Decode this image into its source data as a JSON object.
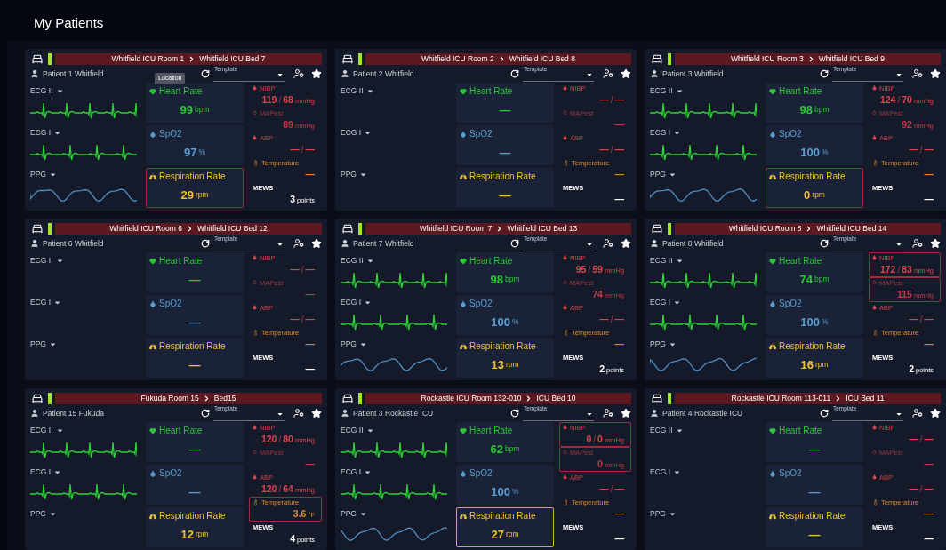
{
  "title": "My Patients",
  "cards": [
    {
      "room": "Whitfield ICU Room 1",
      "bed": "Whitfield ICU Bed 7",
      "patient": "Patient 1 Whitfield",
      "template": "Template",
      "tooltip": "Location",
      "waves": [
        {
          "label": "ECG II",
          "kind": "ecg"
        },
        {
          "label": "ECG I",
          "kind": "ecg"
        },
        {
          "label": "PPG",
          "kind": "ppg"
        }
      ],
      "tiles": [
        {
          "kind": "hr",
          "label": "Heart Rate",
          "value": "99",
          "unit": "bpm",
          "alarm": false
        },
        {
          "kind": "spo2",
          "label": "SpO2",
          "value": "97",
          "unit": "%",
          "alarm": false
        },
        {
          "kind": "rr",
          "label": "Respiration Rate",
          "value": "29",
          "unit": "rpm",
          "alarm": true,
          "color": "#a3283a"
        }
      ],
      "side": [
        {
          "kind": "nibp",
          "label": "NIBP",
          "values": [
            "119",
            "68"
          ],
          "sep": "/",
          "unit": "mmHg",
          "alarm": false
        },
        {
          "kind": "map",
          "label": "MAPest",
          "value": "89",
          "unit": "mmHg",
          "alarm": false
        },
        {
          "kind": "abp",
          "label": "ABP",
          "values": [
            "—",
            "—"
          ],
          "sep": "/",
          "alarm": false
        },
        {
          "kind": "temp",
          "label": "Temperature",
          "value": "—",
          "alarm": false
        },
        {
          "kind": "mews",
          "label": "MEWS",
          "value": "3",
          "unit": "points",
          "alarm": false
        }
      ]
    },
    {
      "room": "Whitfield ICU Room 2",
      "bed": "Whitfield ICU Bed 8",
      "patient": "Patient 2 Whitfield",
      "template": "Template",
      "waves": [
        {
          "label": "ECG II",
          "kind": "empty"
        },
        {
          "label": "ECG I",
          "kind": "empty"
        },
        {
          "label": "PPG",
          "kind": "empty"
        }
      ],
      "tiles": [
        {
          "kind": "hr",
          "label": "Heart Rate",
          "value": "—",
          "alarm": false
        },
        {
          "kind": "spo2",
          "label": "SpO2",
          "value": "—",
          "alarm": false
        },
        {
          "kind": "rr",
          "label": "Respiration Rate",
          "value": "—",
          "alarm": false
        }
      ],
      "side": [
        {
          "kind": "nibp",
          "label": "NIBP",
          "values": [
            "—",
            "—"
          ],
          "sep": "/",
          "alarm": false
        },
        {
          "kind": "map",
          "label": "MAPest",
          "value": "—",
          "alarm": false
        },
        {
          "kind": "abp",
          "label": "ABP",
          "values": [
            "—",
            "—"
          ],
          "sep": "/",
          "alarm": false
        },
        {
          "kind": "temp",
          "label": "Temperature",
          "value": "—",
          "alarm": false
        },
        {
          "kind": "mews",
          "label": "MEWS",
          "value": "—",
          "alarm": false
        }
      ]
    },
    {
      "room": "Whitfield ICU Room 3",
      "bed": "Whitfield ICU Bed 9",
      "patient": "Patient 3 Whitfield",
      "template": "Template",
      "waves": [
        {
          "label": "ECG II",
          "kind": "ecg"
        },
        {
          "label": "ECG I",
          "kind": "ecg"
        },
        {
          "label": "PPG",
          "kind": "ppg"
        }
      ],
      "tiles": [
        {
          "kind": "hr",
          "label": "Heart Rate",
          "value": "98",
          "unit": "bpm",
          "alarm": false
        },
        {
          "kind": "spo2",
          "label": "SpO2",
          "value": "100",
          "unit": "%",
          "alarm": false
        },
        {
          "kind": "rr",
          "label": "Respiration Rate",
          "value": "0",
          "unit": "rpm",
          "alarm": true,
          "color": "#a3283a"
        }
      ],
      "side": [
        {
          "kind": "nibp",
          "label": "NIBP",
          "values": [
            "124",
            "70"
          ],
          "sep": "/",
          "unit": "mmHg",
          "alarm": false
        },
        {
          "kind": "map",
          "label": "MAPest",
          "value": "92",
          "unit": "mmHg",
          "alarm": false
        },
        {
          "kind": "abp",
          "label": "ABP",
          "values": [
            "—",
            "—"
          ],
          "sep": "/",
          "alarm": false
        },
        {
          "kind": "temp",
          "label": "Temperature",
          "value": "—",
          "alarm": false
        },
        {
          "kind": "mews",
          "label": "MEWS",
          "value": "—",
          "alarm": false
        }
      ]
    },
    {
      "room": "Whitfield ICU Room 6",
      "bed": "Whitfield ICU Bed 12",
      "patient": "Patient 6 Whitfield",
      "template": "Template",
      "waves": [
        {
          "label": "ECG II",
          "kind": "empty"
        },
        {
          "label": "ECG I",
          "kind": "empty"
        },
        {
          "label": "PPG",
          "kind": "empty"
        }
      ],
      "tiles": [
        {
          "kind": "hr",
          "label": "Heart Rate",
          "value": "—",
          "alarm": false
        },
        {
          "kind": "spo2",
          "label": "SpO2",
          "value": "—",
          "alarm": false
        },
        {
          "kind": "rr",
          "label": "Respiration Rate",
          "value": "—",
          "alarm": false
        }
      ],
      "side": [
        {
          "kind": "nibp",
          "label": "NIBP",
          "values": [
            "—",
            "—"
          ],
          "sep": "/",
          "alarm": false
        },
        {
          "kind": "map",
          "label": "MAPest",
          "value": "—",
          "alarm": false
        },
        {
          "kind": "abp",
          "label": "ABP",
          "values": [
            "—",
            "—"
          ],
          "sep": "/",
          "alarm": false
        },
        {
          "kind": "temp",
          "label": "Temperature",
          "value": "—",
          "alarm": false
        },
        {
          "kind": "mews",
          "label": "MEWS",
          "value": "—",
          "alarm": false
        }
      ]
    },
    {
      "room": "Whitfield ICU Room 7",
      "bed": "Whitfield ICU Bed 13",
      "patient": "Patient 7 Whitfield",
      "template": "Template",
      "waves": [
        {
          "label": "ECG II",
          "kind": "ecg"
        },
        {
          "label": "ECG I",
          "kind": "ecg"
        },
        {
          "label": "PPG",
          "kind": "ppg"
        }
      ],
      "tiles": [
        {
          "kind": "hr",
          "label": "Heart Rate",
          "value": "98",
          "unit": "bpm",
          "alarm": false
        },
        {
          "kind": "spo2",
          "label": "SpO2",
          "value": "100",
          "unit": "%",
          "alarm": false
        },
        {
          "kind": "rr",
          "label": "Respiration Rate",
          "value": "13",
          "unit": "rpm",
          "alarm": false
        }
      ],
      "side": [
        {
          "kind": "nibp",
          "label": "NIBP",
          "values": [
            "95",
            "59"
          ],
          "sep": "/",
          "unit": "mmHg",
          "alarm": false
        },
        {
          "kind": "map",
          "label": "MAPest",
          "value": "74",
          "unit": "mmHg",
          "alarm": false
        },
        {
          "kind": "abp",
          "label": "ABP",
          "values": [
            "—",
            "—"
          ],
          "sep": "/",
          "alarm": false
        },
        {
          "kind": "temp",
          "label": "Temperature",
          "value": "—",
          "alarm": false
        },
        {
          "kind": "mews",
          "label": "MEWS",
          "value": "2",
          "unit": "points",
          "alarm": false
        }
      ]
    },
    {
      "room": "Whitfield ICU Room 8",
      "bed": "Whitfield ICU Bed 14",
      "patient": "Patient 8 Whitfield",
      "template": "Template",
      "waves": [
        {
          "label": "ECG II",
          "kind": "ecg"
        },
        {
          "label": "ECG I",
          "kind": "ecg"
        },
        {
          "label": "PPG",
          "kind": "ppg"
        }
      ],
      "tiles": [
        {
          "kind": "hr",
          "label": "Heart Rate",
          "value": "74",
          "unit": "bpm",
          "alarm": false
        },
        {
          "kind": "spo2",
          "label": "SpO2",
          "value": "100",
          "unit": "%",
          "alarm": false
        },
        {
          "kind": "rr",
          "label": "Respiration Rate",
          "value": "16",
          "unit": "rpm",
          "alarm": false
        }
      ],
      "side": [
        {
          "kind": "nibp",
          "label": "NIBP",
          "values": [
            "172",
            "83"
          ],
          "sep": "/",
          "unit": "mmHg",
          "alarm": true,
          "color": "#a3283a"
        },
        {
          "kind": "map",
          "label": "MAPest",
          "value": "115",
          "unit": "mmHg",
          "alarm": true,
          "color": "#a3283a"
        },
        {
          "kind": "abp",
          "label": "ABP",
          "values": [
            "—",
            "—"
          ],
          "sep": "/",
          "alarm": false
        },
        {
          "kind": "temp",
          "label": "Temperature",
          "value": "—",
          "alarm": false
        },
        {
          "kind": "mews",
          "label": "MEWS",
          "value": "2",
          "unit": "points",
          "alarm": false
        }
      ]
    },
    {
      "room": "Fukuda Room 15",
      "bed": "Bed15",
      "patient": "Patient 15 Fukuda",
      "template": "Template",
      "waves": [
        {
          "label": "ECG II",
          "kind": "ecg"
        },
        {
          "label": "ECG I",
          "kind": "ecg"
        },
        {
          "label": "PPG",
          "kind": "empty"
        }
      ],
      "tiles": [
        {
          "kind": "hr",
          "label": "Heart Rate",
          "value": "—",
          "alarm": false
        },
        {
          "kind": "spo2",
          "label": "SpO2",
          "value": "—",
          "alarm": false
        },
        {
          "kind": "rr",
          "label": "Respiration Rate",
          "value": "12",
          "unit": "rpm",
          "alarm": false
        }
      ],
      "side": [
        {
          "kind": "nibp",
          "label": "NIBP",
          "values": [
            "120",
            "80"
          ],
          "sep": "/",
          "unit": "mmHg",
          "alarm": false
        },
        {
          "kind": "map",
          "label": "MAPest",
          "value": "—",
          "alarm": false
        },
        {
          "kind": "abp",
          "label": "ABP",
          "values": [
            "120",
            "64"
          ],
          "sep": "/",
          "unit": "mmHg",
          "alarm": false
        },
        {
          "kind": "temp",
          "label": "Temperature",
          "value": "3.6",
          "unit": "°F",
          "alarm": true,
          "color": "#a3283a"
        },
        {
          "kind": "mews",
          "label": "MEWS",
          "value": "4",
          "unit": "points",
          "alarm": false
        }
      ]
    },
    {
      "room": "Rockastle ICU Room 132-010",
      "bed": "ICU Bed 10",
      "patient": "Patient 3 Rockastle ICU",
      "template": "Template",
      "waves": [
        {
          "label": "ECG II",
          "kind": "ecg"
        },
        {
          "label": "ECG I",
          "kind": "ecg"
        },
        {
          "label": "PPG",
          "kind": "ppg"
        }
      ],
      "tiles": [
        {
          "kind": "hr",
          "label": "Heart Rate",
          "value": "62",
          "unit": "bpm",
          "alarm": false
        },
        {
          "kind": "spo2",
          "label": "SpO2",
          "value": "100",
          "unit": "%",
          "alarm": false
        },
        {
          "kind": "rr",
          "label": "Respiration Rate",
          "value": "27",
          "unit": "rpm",
          "alarm": true,
          "color": "#d8b41e"
        }
      ],
      "side": [
        {
          "kind": "nibp",
          "label": "NIBP",
          "values": [
            "0",
            "0"
          ],
          "sep": "/",
          "unit": "mmHg",
          "alarm": true,
          "color": "#a3283a"
        },
        {
          "kind": "map",
          "label": "MAPest",
          "value": "0",
          "unit": "mmHg",
          "alarm": true,
          "color": "#a3283a"
        },
        {
          "kind": "abp",
          "label": "ABP",
          "values": [
            "—",
            "—"
          ],
          "sep": "/",
          "alarm": false
        },
        {
          "kind": "temp",
          "label": "Temperature",
          "value": "—",
          "alarm": false
        },
        {
          "kind": "mews",
          "label": "MEWS",
          "value": "—",
          "alarm": false
        }
      ]
    },
    {
      "room": "Rockastle ICU Room 113-011",
      "bed": "ICU Bed 11",
      "patient": "Patient 4 Rockastle ICU",
      "template": "Template",
      "waves": [
        {
          "label": "ECG II",
          "kind": "empty"
        },
        {
          "label": "ECG I",
          "kind": "empty"
        },
        {
          "label": "PPG",
          "kind": "empty"
        }
      ],
      "tiles": [
        {
          "kind": "hr",
          "label": "Heart Rate",
          "value": "—",
          "alarm": false
        },
        {
          "kind": "spo2",
          "label": "SpO2",
          "value": "—",
          "alarm": false
        },
        {
          "kind": "rr",
          "label": "Respiration Rate",
          "value": "—",
          "alarm": false
        }
      ],
      "side": [
        {
          "kind": "nibp",
          "label": "NIBP",
          "values": [
            "—",
            "—"
          ],
          "sep": "/",
          "alarm": false
        },
        {
          "kind": "map",
          "label": "MAPest",
          "value": "—",
          "alarm": false
        },
        {
          "kind": "abp",
          "label": "ABP",
          "values": [
            "—",
            "—"
          ],
          "sep": "/",
          "alarm": false
        },
        {
          "kind": "temp",
          "label": "Temperature",
          "value": "—",
          "alarm": false
        },
        {
          "kind": "mews",
          "label": "MEWS",
          "value": "—",
          "alarm": false
        }
      ]
    }
  ]
}
